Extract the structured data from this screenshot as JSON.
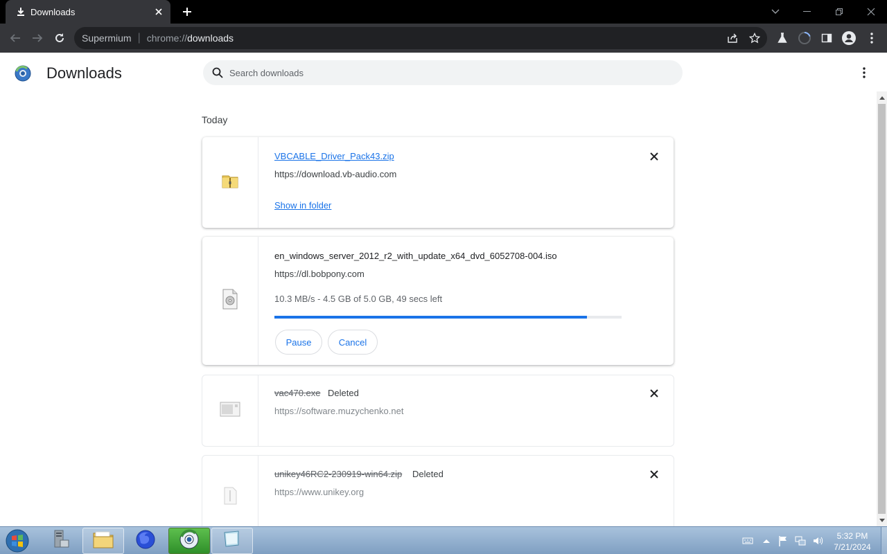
{
  "tab": {
    "title": "Downloads"
  },
  "omnibox": {
    "site": "Supermium",
    "scheme": "chrome://",
    "host": "downloads"
  },
  "header": {
    "title": "Downloads",
    "search_placeholder": "Search downloads"
  },
  "date_heading": "Today",
  "downloads": [
    {
      "file_name": "VBCABLE_Driver_Pack43.zip",
      "url": "https://download.vb-audio.com",
      "action_label": "Show in folder"
    },
    {
      "file_name": "en_windows_server_2012_r2_with_update_x64_dvd_6052708-004.iso",
      "url": "https://dl.bobpony.com",
      "status": "10.3 MB/s - 4.5 GB of 5.0 GB, 49 secs left",
      "progress": 0.9,
      "pause_label": "Pause",
      "cancel_label": "Cancel"
    },
    {
      "file_name": "vac470.exe",
      "state_label": "Deleted",
      "url": "https://software.muzychenko.net"
    },
    {
      "file_name": "unikey46RC2-230919-win64.zip",
      "state_label": "Deleted",
      "url": "https://www.unikey.org"
    }
  ],
  "taskbar": {
    "time": "5:32 PM",
    "date": "7/21/2024"
  },
  "colors": {
    "accent": "#1a73e8",
    "chrome_dark": "#35363a",
    "omnibox": "#202124"
  }
}
